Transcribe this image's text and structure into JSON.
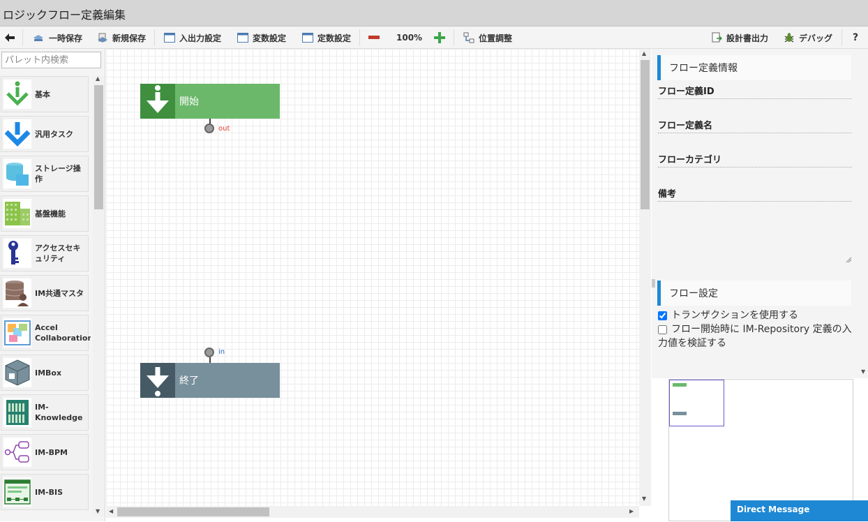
{
  "window": {
    "title": "ロジックフロー定義編集"
  },
  "toolbar": {
    "temp_save": "一時保存",
    "new_save": "新規保存",
    "io_settings": "入出力設定",
    "var_settings": "変数設定",
    "const_settings": "定数設定",
    "zoom": "100%",
    "position_adjust": "位置調整",
    "design_doc_output": "設計書出力",
    "debug": "デバッグ",
    "help": "?"
  },
  "palette": {
    "search_placeholder": "パレット内検索",
    "items": [
      {
        "label": "基本",
        "icon": "down-arrow-green-icon"
      },
      {
        "label": "汎用タスク",
        "icon": "down-arrow-blue-icon"
      },
      {
        "label": "ストレージ操作",
        "icon": "storage-icon"
      },
      {
        "label": "基盤機能",
        "icon": "grid-green-icon"
      },
      {
        "label": "アクセスセキュリティ",
        "icon": "key-icon"
      },
      {
        "label": "IM共通マスタ",
        "icon": "database-user-icon"
      },
      {
        "label": "Accel Collaboration",
        "icon": "collaboration-icon"
      },
      {
        "label": "IMBox",
        "icon": "box-icon"
      },
      {
        "label": "IM-Knowledge",
        "icon": "books-icon"
      },
      {
        "label": "IM-BPM",
        "icon": "bpm-flow-icon"
      },
      {
        "label": "IM-BIS",
        "icon": "bis-screen-icon"
      }
    ]
  },
  "canvas": {
    "start_node": {
      "label": "開始",
      "out_port": "out"
    },
    "end_node": {
      "label": "終了",
      "in_port": "in"
    }
  },
  "props": {
    "flow_info_header": "フロー定義情報",
    "flow_id_label": "フロー定義ID",
    "flow_name_label": "フロー定義名",
    "flow_category_label": "フローカテゴリ",
    "remarks_label": "備考",
    "flow_settings_header": "フロー設定",
    "use_transaction": "トランザクションを使用する",
    "use_transaction_checked": true,
    "validate_input_line1": "フロー開始時に IM-Repository 定義の入",
    "validate_input_line2": "力値を検証する",
    "validate_input_checked": false
  },
  "direct_message": "Direct Message",
  "colors": {
    "start_node": "#6bb86b",
    "start_node_dark": "#3f8f3f",
    "end_node": "#78909c",
    "end_node_dark": "#455a64",
    "accent": "#1e88d4"
  }
}
